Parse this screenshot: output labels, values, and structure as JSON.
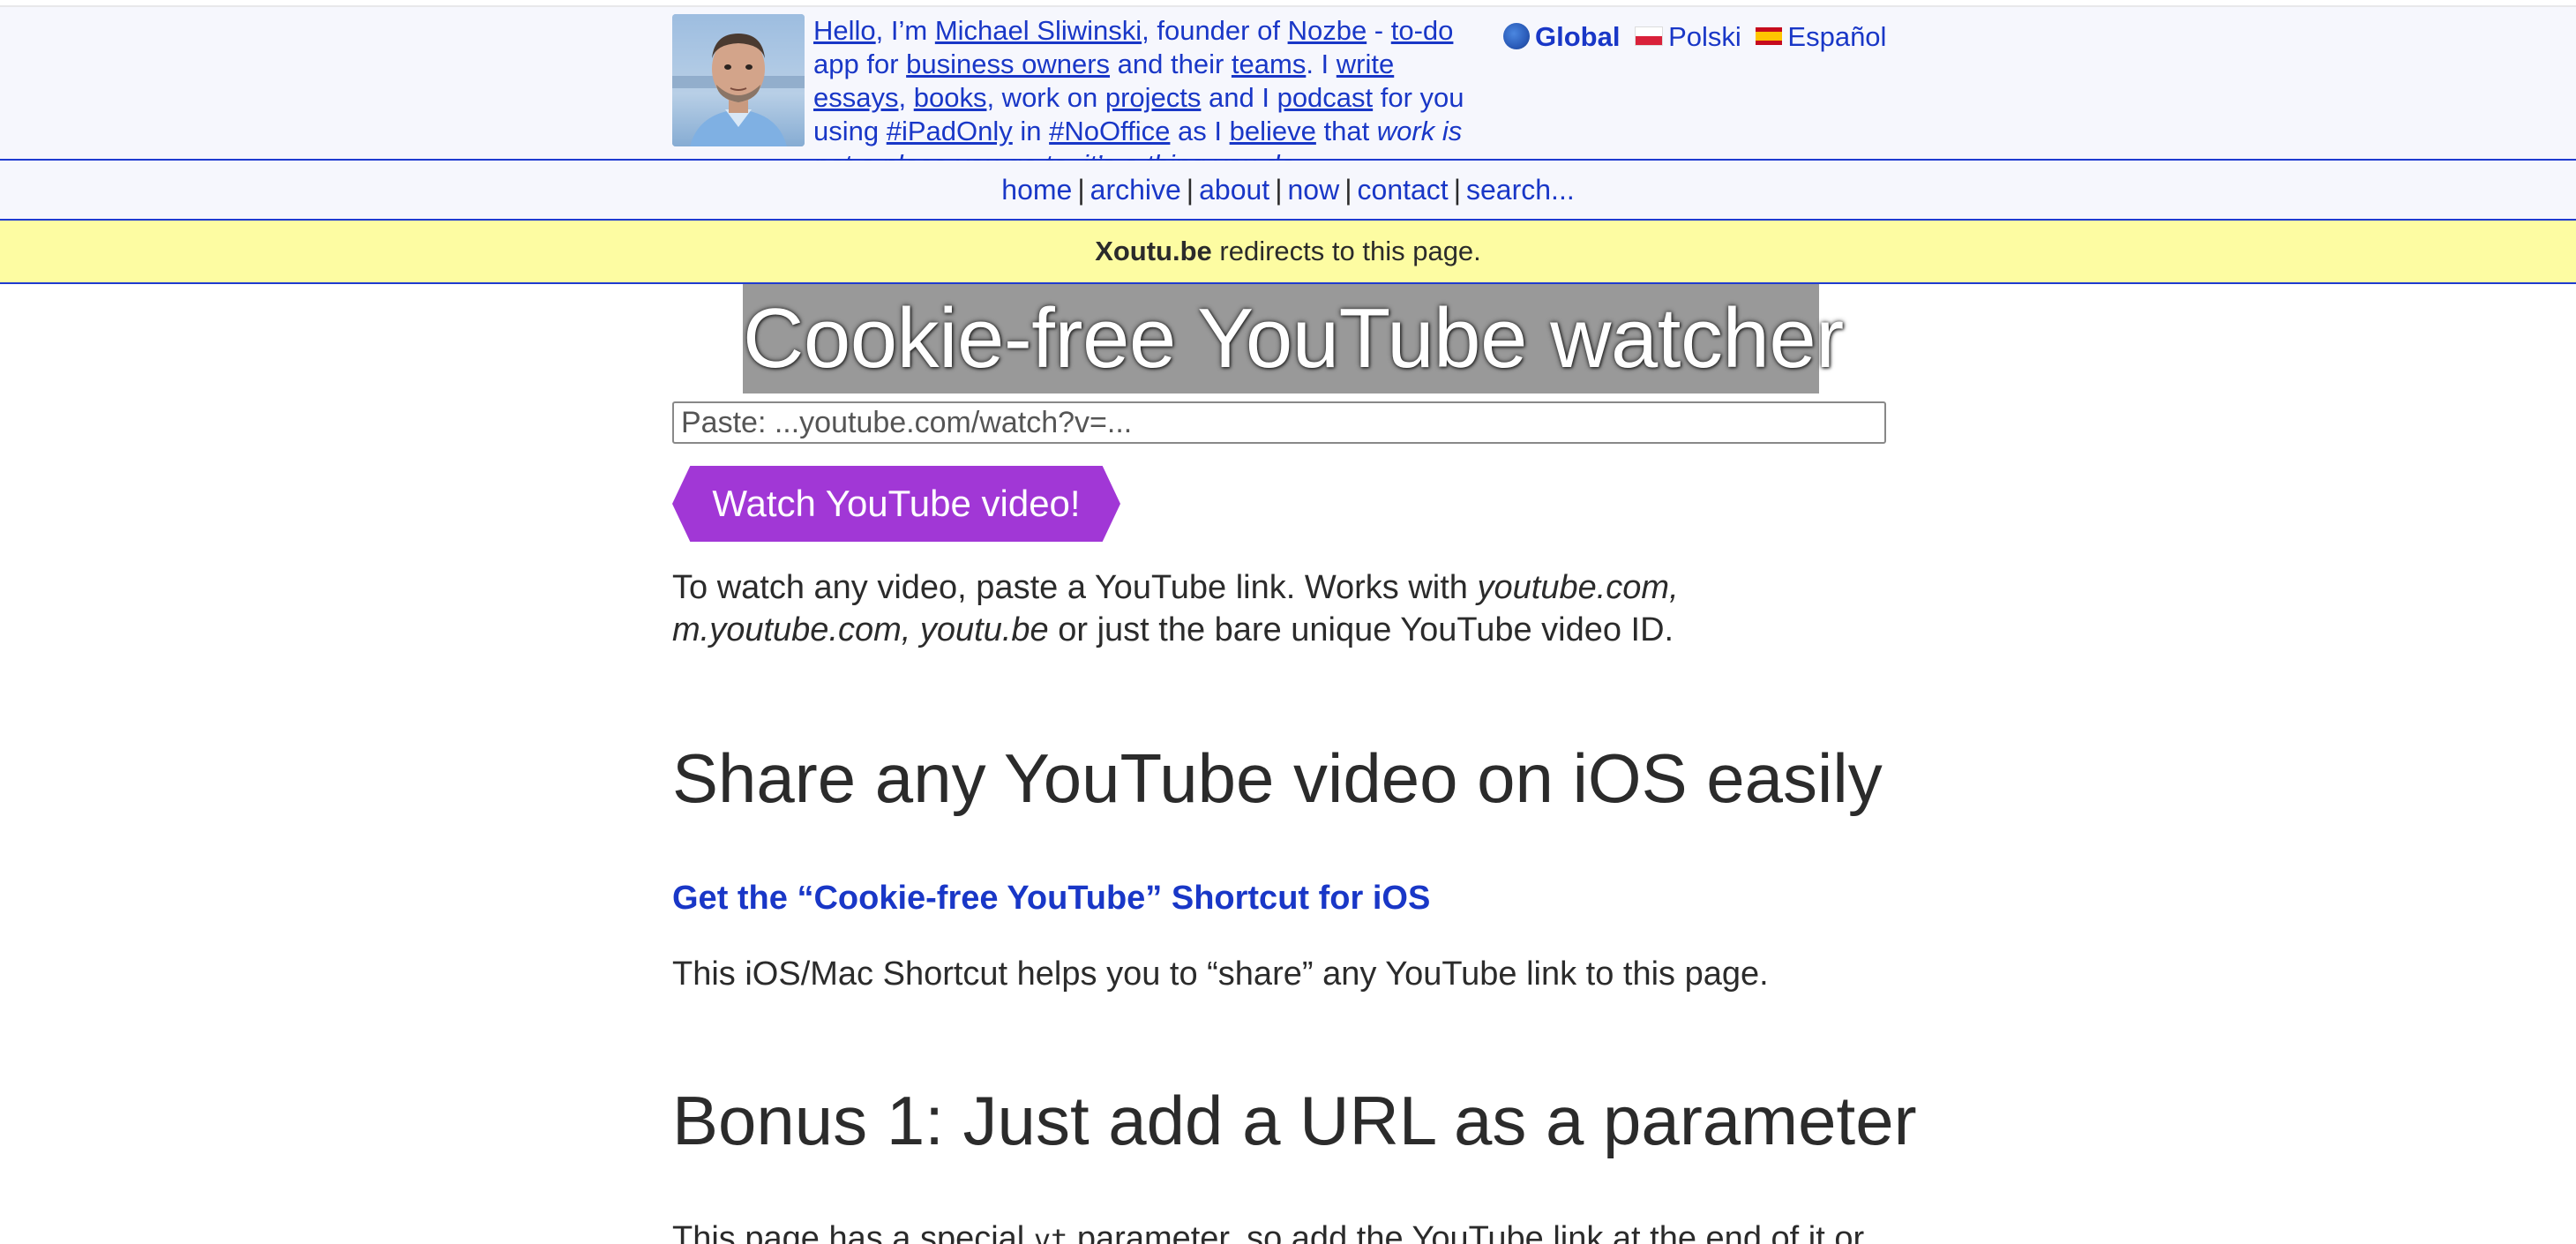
{
  "header": {
    "avatar_alt": "Michael Sliwinski",
    "intro": {
      "hello": "Hello",
      "im": ", I’m ",
      "name": "Michael Sliwinski",
      "founder_of": ", founder of ",
      "nozbe": "Nozbe",
      "dash": " - ",
      "todo": "to-do",
      "app_for": " app for ",
      "business_owners": "business owners",
      "and_their": " and their ",
      "teams": "teams",
      "i": ". I ",
      "write": "write essays",
      "comma": ", ",
      "books": "books",
      "work_on": ", work on ",
      "projects": "projects",
      "and_i": " and I ",
      "podcast": "podcast",
      "for_you": " for you using ",
      "ipadonly": "#iPadOnly",
      "in": " in ",
      "nooffice": "#NoOffice",
      "as_i": " as I ",
      "believe": "believe",
      "that": " that ",
      "quote": "work is not a place you go to, it’s a thing you do."
    },
    "languages": {
      "global": "Global",
      "polski": "Polski",
      "espanol": "Español"
    }
  },
  "nav": {
    "home": "home",
    "archive": "archive",
    "about": "about",
    "now": "now",
    "contact": "contact",
    "search": "search..."
  },
  "notice": {
    "domain": "Xoutu.be",
    "text": " redirects to this page."
  },
  "main": {
    "title": "Cookie-free YouTube watcher",
    "input_placeholder": "Paste: ...youtube.com/watch?v=...",
    "watch_button": "Watch YouTube video!",
    "desc_start": "To watch any video, paste a YouTube link. Works with ",
    "desc_domains1": "youtube.com,",
    "desc_domains2": "m.youtube.com, youtu.be",
    "desc_end": " or just the bare unique YouTube video ID.",
    "h2_share": "Share any YouTube video on iOS easily",
    "shortcut_link": "Get the “Cookie-free YouTube” Shortcut for iOS",
    "shortcut_desc": "This iOS/Mac Shortcut helps you to “share” any YouTube link to this page.",
    "h2_bonus": "Bonus 1: Just add a URL as a parameter",
    "bonus_desc_start": "This page has a special ",
    "bonus_param": "vt",
    "bonus_desc_end": " parameter, so add the YouTube link at the end of it or"
  },
  "colors": {
    "link": "#1937c7",
    "header_bg": "#f6f7fd",
    "notice_bg": "#fdfca2",
    "button_bg": "#a137d6",
    "title_bg": "#999999"
  }
}
